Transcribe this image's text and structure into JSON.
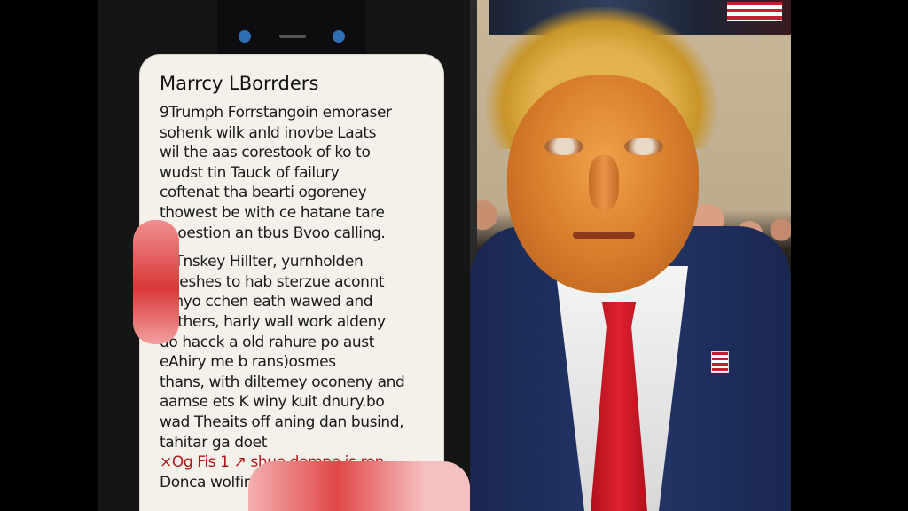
{
  "photo": {
    "description_free": true,
    "paper": {
      "title": "Marrcy LBorrders",
      "lines": [
        "9Trumph Forrstangoin emoraser",
        "sohenk wilk anld inovbe Laats",
        "wil the aas corestook of ko to",
        "wudst tin Tauck of failury",
        "coftenat tha bearti ogoreney",
        "thowest be with ce hatane tare",
        "onoestion an tbus Bvoo calling.",
        "N-Tnskey Hillter, yurnholden",
        "I Deshes to hab sterzue aconnt",
        "Whyo cchen eath wawed and",
        "abthers, harly wall work aldeny",
        "do hacck a old rahure po aust",
        "eAhiry me b rans)osmes",
        "thans, with diltemey oconeny and",
        "aamse ets K winy kuit dnury.bo",
        "wad Theaits off aning dan busind,",
        "                tahitar ga doet",
        "×Og Fis 1 ↗ shue domne is ron",
        "Donca wolfinge"
      ]
    }
  }
}
